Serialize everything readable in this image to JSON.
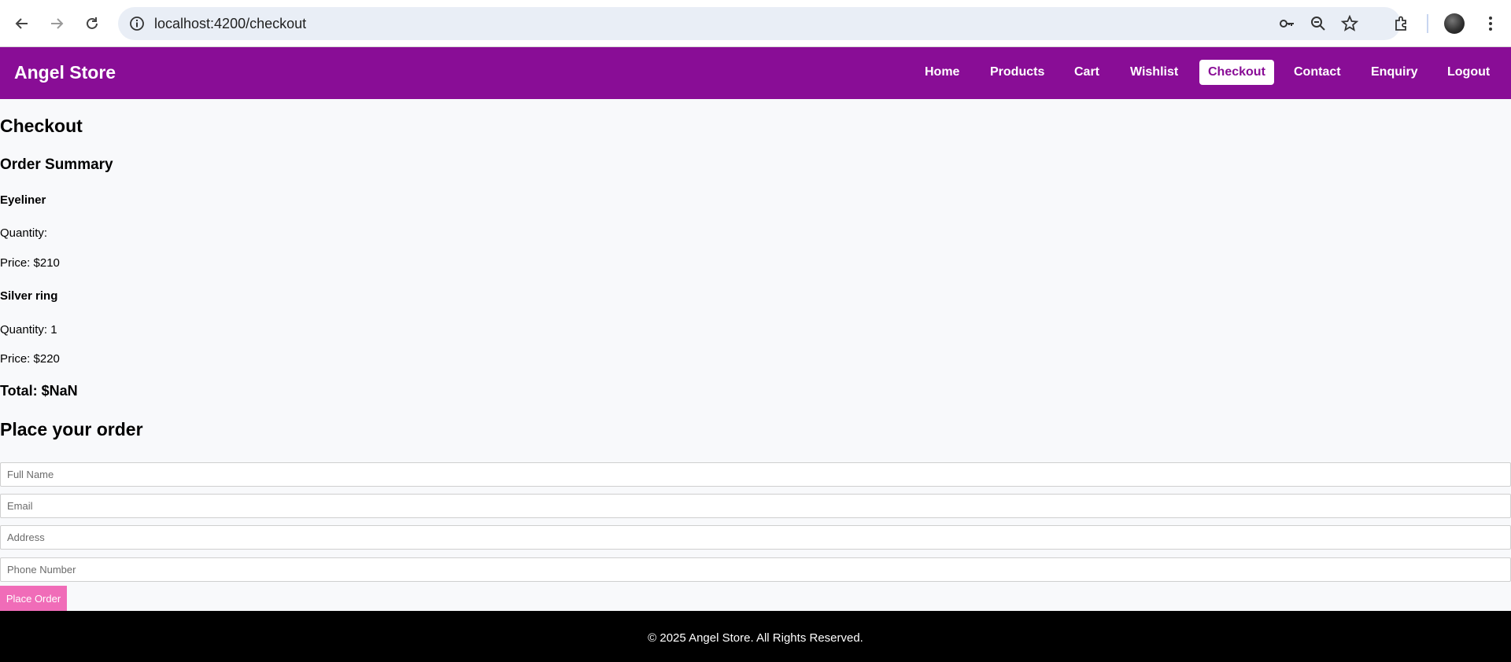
{
  "browser": {
    "url": "localhost:4200/checkout",
    "icons": [
      "back-arrow-icon",
      "forward-arrow-icon",
      "reload-icon",
      "site-info-icon",
      "password-key-icon",
      "zoom-icon",
      "bookmark-star-icon",
      "extensions-icon",
      "profile-avatar",
      "more-menu-icon"
    ]
  },
  "header": {
    "brand": "Angel Store",
    "nav": [
      {
        "label": "Home"
      },
      {
        "label": "Products"
      },
      {
        "label": "Cart"
      },
      {
        "label": "Wishlist"
      },
      {
        "label": "Checkout",
        "active": true
      },
      {
        "label": "Contact"
      },
      {
        "label": "Enquiry"
      }
    ],
    "logout": "Logout",
    "color": "#890d96"
  },
  "main": {
    "title": "Checkout",
    "summary_title": "Order Summary",
    "items": [
      {
        "name": "Eyeliner",
        "quantity": "Quantity:",
        "price": "Price: $210"
      },
      {
        "name": "Silver ring",
        "quantity": "Quantity: 1",
        "price": "Price: $220"
      }
    ],
    "total": "Total: $NaN",
    "order_title": "Place your order",
    "form": {
      "full_name_placeholder": "Full Name",
      "email_placeholder": "Email",
      "address_placeholder": "Address",
      "phone_placeholder": "Phone Number",
      "submit_label": "Place Order"
    },
    "button_color": "#f06cb8"
  },
  "footer": {
    "text": "© 2025 Angel Store. All Rights Reserved."
  }
}
